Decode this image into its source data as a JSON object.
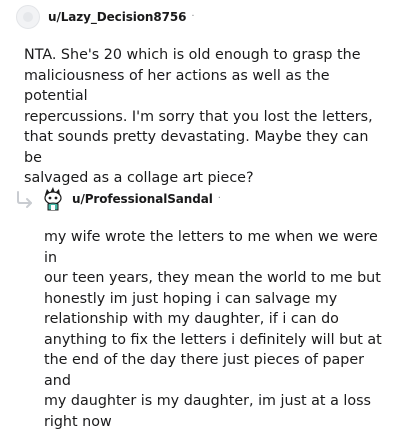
{
  "comments": [
    {
      "username": "u/Lazy_Decision8756",
      "separator": "·",
      "avatar_icon": "default-avatar-icon",
      "body": "NTA. She's 20 which is old enough to grasp the\nmaliciousness of her actions as well as the potential\nrepercussions. I'm sorry that you lost the letters,\nthat sounds pretty devastating. Maybe they can be\nsalvaged as a collage art piece?"
    },
    {
      "username": "u/ProfessionalSandal",
      "separator": "·",
      "avatar_icon": "snoo-avatar-icon",
      "reply_icon": "reply-arrow-icon",
      "body": "my wife wrote the letters to me when we were in\nour teen years, they mean the world to me but\nhonestly im just hoping i can salvage my\nrelationship with my daughter, if i can do\nanything to fix the letters i definitely will but at\nthe end of the day there just pieces of paper and\nmy daughter is my daughter, im just at a loss\nright now"
    }
  ],
  "colors": {
    "text": "#1a1a1b",
    "meta": "#878a8c",
    "reply_arrow": "#c9ccd1"
  }
}
